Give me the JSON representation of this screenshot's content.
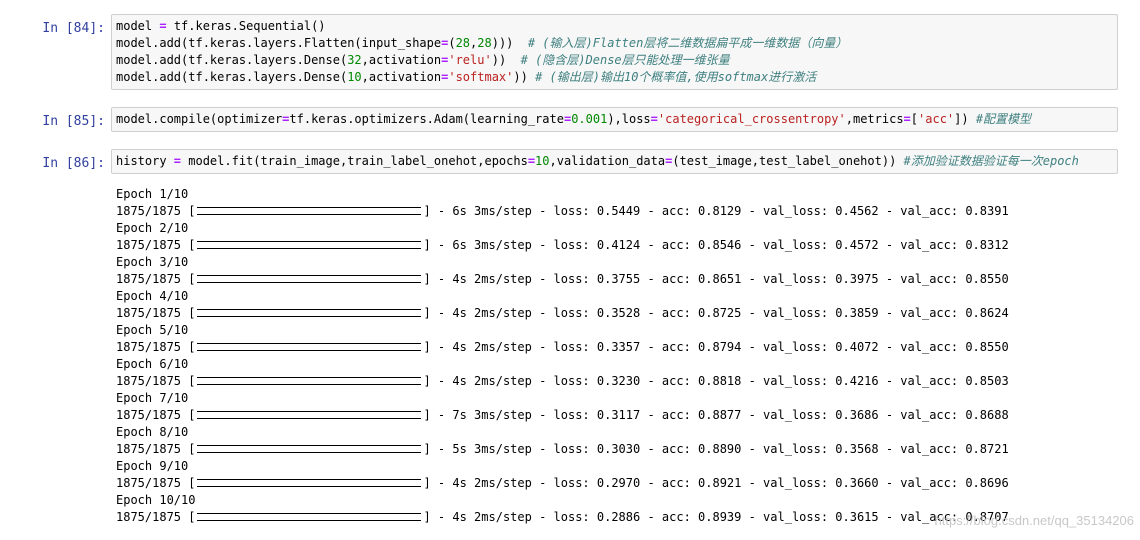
{
  "cells": [
    {
      "prompt": "In  [84]:",
      "lines": [
        [
          [
            "t",
            "model "
          ],
          [
            "o",
            "="
          ],
          [
            "t",
            " tf.keras.Sequential()"
          ]
        ],
        [
          [
            "t",
            "model.add(tf.keras.layers.Flatten(input_shape"
          ],
          [
            "o",
            "="
          ],
          [
            "t",
            "("
          ],
          [
            "n",
            "28"
          ],
          [
            "t",
            ","
          ],
          [
            "n",
            "28"
          ],
          [
            "t",
            ")))  "
          ],
          [
            "c",
            "# (输入层)Flatten层将二维数据扁平成一维数据（向量）"
          ]
        ],
        [
          [
            "t",
            "model.add(tf.keras.layers.Dense("
          ],
          [
            "n",
            "32"
          ],
          [
            "t",
            ",activation"
          ],
          [
            "o",
            "="
          ],
          [
            "s",
            "'relu'"
          ],
          [
            "t",
            "))  "
          ],
          [
            "c",
            "# (隐含层)Dense层只能处理一维张量"
          ]
        ],
        [
          [
            "t",
            "model.add(tf.keras.layers.Dense("
          ],
          [
            "n",
            "10"
          ],
          [
            "t",
            ",activation"
          ],
          [
            "o",
            "="
          ],
          [
            "s",
            "'softmax'"
          ],
          [
            "t",
            ")) "
          ],
          [
            "c",
            "# (输出层)输出10个概率值,使用softmax进行激活"
          ]
        ]
      ]
    },
    {
      "prompt": "In  [85]:",
      "lines": [
        [
          [
            "t",
            "model.compile(optimizer"
          ],
          [
            "o",
            "="
          ],
          [
            "t",
            "tf.keras.optimizers.Adam(learning_rate"
          ],
          [
            "o",
            "="
          ],
          [
            "n",
            "0.001"
          ],
          [
            "t",
            "),loss"
          ],
          [
            "o",
            "="
          ],
          [
            "s",
            "'categorical_crossentropy'"
          ],
          [
            "t",
            ",metrics"
          ],
          [
            "o",
            "="
          ],
          [
            "t",
            "["
          ],
          [
            "s",
            "'acc'"
          ],
          [
            "t",
            "]) "
          ],
          [
            "c",
            "#配置模型"
          ]
        ]
      ]
    },
    {
      "prompt": "In  [86]:",
      "lines": [
        [
          [
            "t",
            "history "
          ],
          [
            "o",
            "="
          ],
          [
            "t",
            " model.fit(train_image,train_label_onehot,epochs"
          ],
          [
            "o",
            "="
          ],
          [
            "n",
            "10"
          ],
          [
            "t",
            ",validation_data"
          ],
          [
            "o",
            "="
          ],
          [
            "t",
            "(test_image,test_label_onehot)) "
          ],
          [
            "c",
            "#添加验证数据验证每一次epoch"
          ]
        ]
      ]
    }
  ],
  "output": {
    "epochs": [
      {
        "header": "Epoch 1/10",
        "step": "1875/1875",
        "rest": "- 6s 3ms/step - loss: 0.5449 - acc: 0.8129 - val_loss: 0.4562 - val_acc: 0.8391"
      },
      {
        "header": "Epoch 2/10",
        "step": "1875/1875",
        "rest": "- 6s 3ms/step - loss: 0.4124 - acc: 0.8546 - val_loss: 0.4572 - val_acc: 0.8312"
      },
      {
        "header": "Epoch 3/10",
        "step": "1875/1875",
        "rest": "- 4s 2ms/step - loss: 0.3755 - acc: 0.8651 - val_loss: 0.3975 - val_acc: 0.8550"
      },
      {
        "header": "Epoch 4/10",
        "step": "1875/1875",
        "rest": "- 4s 2ms/step - loss: 0.3528 - acc: 0.8725 - val_loss: 0.3859 - val_acc: 0.8624"
      },
      {
        "header": "Epoch 5/10",
        "step": "1875/1875",
        "rest": "- 4s 2ms/step - loss: 0.3357 - acc: 0.8794 - val_loss: 0.4072 - val_acc: 0.8550"
      },
      {
        "header": "Epoch 6/10",
        "step": "1875/1875",
        "rest": "- 4s 2ms/step - loss: 0.3230 - acc: 0.8818 - val_loss: 0.4216 - val_acc: 0.8503"
      },
      {
        "header": "Epoch 7/10",
        "step": "1875/1875",
        "rest": "- 7s 3ms/step - loss: 0.3117 - acc: 0.8877 - val_loss: 0.3686 - val_acc: 0.8688"
      },
      {
        "header": "Epoch 8/10",
        "step": "1875/1875",
        "rest": "- 5s 3ms/step - loss: 0.3030 - acc: 0.8890 - val_loss: 0.3568 - val_acc: 0.8721"
      },
      {
        "header": "Epoch 9/10",
        "step": "1875/1875",
        "rest": "- 4s 2ms/step - loss: 0.2970 - acc: 0.8921 - val_loss: 0.3660 - val_acc: 0.8696"
      },
      {
        "header": "Epoch 10/10",
        "step": "1875/1875",
        "rest": "- 4s 2ms/step - loss: 0.2886 - acc: 0.8939 - val_loss: 0.3615 - val_acc: 0.8707"
      }
    ]
  },
  "watermark": "https://blog.csdn.net/qq_35134206",
  "colors": {
    "prompt": "#303f9f",
    "comment": "#408080",
    "string": "#ba2121",
    "number": "#008800",
    "operator": "#aa22ff"
  }
}
